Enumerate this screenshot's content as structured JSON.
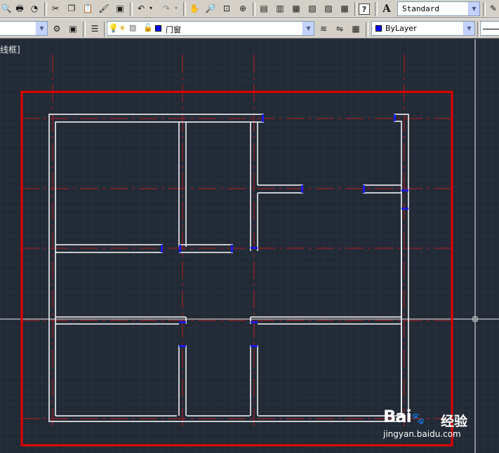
{
  "toolbar1": {
    "buttons": [
      {
        "name": "zoom-realtime-icon",
        "glyph": "🔍"
      },
      {
        "name": "plot-icon",
        "glyph": "🖶"
      },
      {
        "name": "publish-icon",
        "glyph": "◔"
      },
      {
        "name": "cut-icon",
        "glyph": "✂"
      },
      {
        "name": "copy-icon",
        "glyph": "❐"
      },
      {
        "name": "paste-icon",
        "glyph": "📋"
      },
      {
        "name": "match-properties-icon",
        "glyph": "🖌"
      },
      {
        "name": "block-editor-icon",
        "glyph": "▣"
      },
      {
        "name": "undo-icon",
        "glyph": "↶"
      },
      {
        "name": "redo-icon",
        "glyph": "↷"
      },
      {
        "name": "pan-icon",
        "glyph": "✋"
      },
      {
        "name": "zoom-realtime-2-icon",
        "glyph": "🔎"
      },
      {
        "name": "zoom-window-icon",
        "glyph": "⊡"
      },
      {
        "name": "zoom-previous-icon",
        "glyph": "⊕"
      },
      {
        "name": "properties-icon",
        "glyph": "▤"
      },
      {
        "name": "design-center-icon",
        "glyph": "▥"
      },
      {
        "name": "tool-palettes-icon",
        "glyph": "▦"
      },
      {
        "name": "sheet-set-icon",
        "glyph": "▧"
      },
      {
        "name": "markup-icon",
        "glyph": "▨"
      },
      {
        "name": "quickcalc-icon",
        "glyph": "▩"
      },
      {
        "name": "help-icon",
        "glyph": "?"
      }
    ],
    "text_style_icon": "A",
    "text_style_value": "Standard"
  },
  "toolbar2": {
    "layer_value": "门窗",
    "color_value": "ByLayer",
    "layer_color": "#0000ff"
  },
  "viewport": {
    "label": "线框]"
  },
  "colors": {
    "background": "#222a36",
    "wall": "#ffffff",
    "axis": "#cc1f1f",
    "highlight": "#e60000",
    "door_marker": "#1a1ae6"
  },
  "watermark": {
    "logo": "Bai",
    "logo_suffix": "",
    "chinese": "经验",
    "url": "jingyan.baidu.com"
  }
}
